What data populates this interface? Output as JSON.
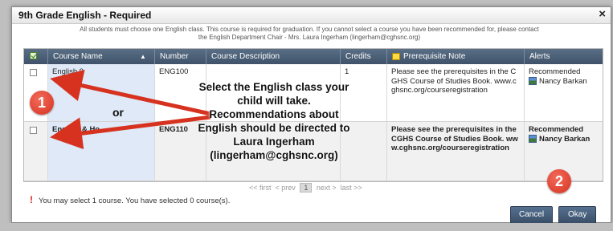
{
  "dialog": {
    "title": "9th Grade English - Required",
    "close_glyph": "×",
    "intro_text": "All students must choose one English class. This course is required for graduation. If you cannot select a course you have been recommended for, please contact the English Department Chair - Mrs. Laura Ingerham (lingerham@cghsnc.org)"
  },
  "table": {
    "headers": {
      "course_name": "Course Name",
      "sort_glyph": "▲",
      "number": "Number",
      "description": "Course Description",
      "credits": "Credits",
      "prereq": "Prerequisite Note",
      "alerts": "Alerts"
    },
    "rows": [
      {
        "course_name": "English 9",
        "number": "ENG100",
        "description": "",
        "credits": "1",
        "prereq": "Please see the prerequisites in the CGHS Course of Studies Book. www.cghsnc.org/courseregistration",
        "alert_status": "Recommended",
        "alert_person": "Nancy Barkan"
      },
      {
        "course_name": "English & Ho...",
        "number": "ENG110",
        "description": "",
        "credits": "",
        "prereq": "Please see the prerequisites in the CGHS Course of Studies Book. www.cghsnc.org/courseregistration",
        "alert_status": "Recommended",
        "alert_person": "Nancy Barkan"
      }
    ]
  },
  "pager": {
    "first": "<< first",
    "prev": "< prev",
    "page": "1",
    "next": "next >",
    "last": "last >>"
  },
  "status": {
    "icon": "!",
    "text": "You may select 1 course.  You have selected 0 course(s)."
  },
  "buttons": {
    "cancel": "Cancel",
    "okay": "Okay"
  },
  "annotations": {
    "overlay_text": "Select the English class your child will take. Recommendations about English should be directed to Laura Ingerham (lingerham@cghsnc.org)",
    "or_text": "or",
    "badge_1": "1",
    "badge_2": "2",
    "badge_color": "#d6321f",
    "arrow_color": "#d6321f"
  },
  "icons": {
    "close": "close-icon",
    "select_all": "checkbox-checked-icon",
    "prereq": "sticky-note-icon",
    "alert_person": "person-icon",
    "warning": "warning-exclamation-icon"
  }
}
